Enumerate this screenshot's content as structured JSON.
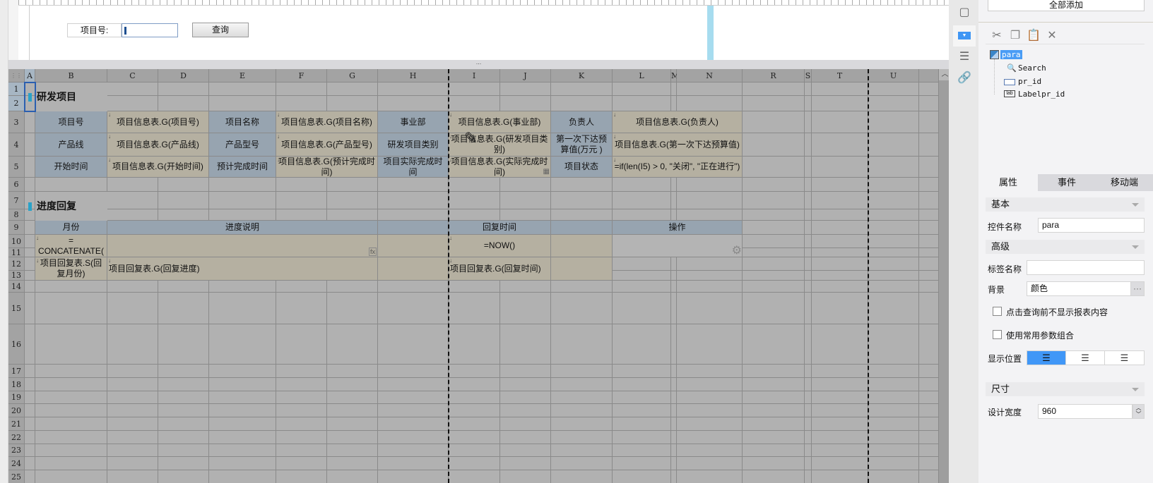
{
  "param_pane": {
    "label": "项目号:",
    "input_value": "",
    "query_button": "查询",
    "divider_grip": "..."
  },
  "sheet": {
    "corner": "⋮⋮",
    "columns": [
      "A",
      "B",
      "C",
      "D",
      "E",
      "F",
      "G",
      "H",
      "I",
      "J",
      "K",
      "L",
      "M",
      "N",
      "R",
      "S",
      "T",
      "U"
    ],
    "rows": [
      "1",
      "2",
      "3",
      "4",
      "5",
      "6",
      "7",
      "8",
      "9",
      "10",
      "11",
      "12",
      "13",
      "14",
      "15",
      "16",
      "17",
      "18",
      "19",
      "20",
      "21",
      "22",
      "23",
      "24",
      "25"
    ],
    "selected_cell": "A1:A2",
    "cells": [
      {
        "ref": "B1:B2",
        "text": "研发项目",
        "style": "heading"
      },
      {
        "ref": "B3",
        "text": "项目号",
        "style": "label"
      },
      {
        "ref": "C3:D3",
        "text": "项目信息表.G(项目号)",
        "style": "data"
      },
      {
        "ref": "E3",
        "text": "项目名称",
        "style": "label"
      },
      {
        "ref": "F3:G3",
        "text": "项目信息表.G(项目名称)",
        "style": "data"
      },
      {
        "ref": "H3",
        "text": "事业部",
        "style": "label"
      },
      {
        "ref": "I3:J3",
        "text": "项目信息表.G(事业部)",
        "style": "data"
      },
      {
        "ref": "K3",
        "text": "负责人",
        "style": "label"
      },
      {
        "ref": "L3:N3",
        "text": "项目信息表.G(负责人)",
        "style": "data"
      },
      {
        "ref": "B4",
        "text": "产品线",
        "style": "label"
      },
      {
        "ref": "C4:D4",
        "text": "项目信息表.G(产品线)",
        "style": "data"
      },
      {
        "ref": "E4",
        "text": "产品型号",
        "style": "label"
      },
      {
        "ref": "F4:G4",
        "text": "项目信息表.G(产品型号)",
        "style": "data"
      },
      {
        "ref": "H4",
        "text": "研发项目类别",
        "style": "label"
      },
      {
        "ref": "I4:J4",
        "text": "项目信息表.G(研发项目类别)",
        "style": "data"
      },
      {
        "ref": "K4",
        "text": "第一次下达预算值(万元 )",
        "style": "label"
      },
      {
        "ref": "L4:N4",
        "text": "项目信息表.G(第一次下达预算值)",
        "style": "data"
      },
      {
        "ref": "B5",
        "text": "开始时间",
        "style": "label"
      },
      {
        "ref": "C5:D5",
        "text": "项目信息表.G(开始时间)",
        "style": "data"
      },
      {
        "ref": "E5",
        "text": "预计完成时间",
        "style": "label"
      },
      {
        "ref": "F5:G5",
        "text": "项目信息表.G(预计完成时间)",
        "style": "data"
      },
      {
        "ref": "H5",
        "text": "项目实际完成时间",
        "style": "label"
      },
      {
        "ref": "I5:J5",
        "text": "项目信息表.G(实际完成时间)",
        "style": "data"
      },
      {
        "ref": "K5",
        "text": "项目状态",
        "style": "label"
      },
      {
        "ref": "L5:N5",
        "text": "=if(len(I5) > 0, \"关闭\", \"正在进行\")",
        "style": "data"
      },
      {
        "ref": "B7:B8",
        "text": "进度回复",
        "style": "heading"
      },
      {
        "ref": "B9",
        "text": "月份",
        "style": "label"
      },
      {
        "ref": "C9:G9",
        "text": "进度说明",
        "style": "label"
      },
      {
        "ref": "H9",
        "text": "",
        "style": "label"
      },
      {
        "ref": "I9:J9",
        "text": "回复时间",
        "style": "label"
      },
      {
        "ref": "K9",
        "text": "",
        "style": "label"
      },
      {
        "ref": "L9:N9",
        "text": "操作",
        "style": "label"
      },
      {
        "ref": "B10:B11",
        "text": "= CONCATENATE(",
        "style": "data"
      },
      {
        "ref": "C10:G11",
        "text": "",
        "style": "data"
      },
      {
        "ref": "H10:H11",
        "text": "",
        "style": "data"
      },
      {
        "ref": "I10:J11",
        "text": "=NOW()",
        "style": "data"
      },
      {
        "ref": "K10:K11",
        "text": "",
        "style": "data"
      },
      {
        "ref": "L10:N11",
        "text": "",
        "style": "op"
      },
      {
        "ref": "B12:B13",
        "text": "项目回复表.S(回复月份)",
        "style": "data"
      },
      {
        "ref": "C12:G13",
        "text": "项目回复表.G(回复进度)",
        "style": "data left"
      },
      {
        "ref": "H12:H13",
        "text": "",
        "style": "data"
      },
      {
        "ref": "I12:J13",
        "text": "项目回复表.G(回复时间)",
        "style": "data left"
      },
      {
        "ref": "K12:K13",
        "text": "",
        "style": "data"
      }
    ],
    "formula_badge": "fx"
  },
  "widget_panel": {
    "add_all_button": "全部添加",
    "toolbar": [
      "cut-icon",
      "copy-icon",
      "paste-icon",
      "delete-icon"
    ],
    "tree": [
      {
        "label": "para",
        "selected": true
      },
      {
        "label": "Search"
      },
      {
        "label": "pr_id"
      },
      {
        "label": "Labelpr_id"
      }
    ],
    "tree_icon_lab": "lab"
  },
  "properties": {
    "tabs": [
      "属性",
      "事件",
      "移动端"
    ],
    "active_tab": "属性",
    "section_basic": "基本",
    "widget_name_label": "控件名称",
    "widget_name_value": "para",
    "section_advanced": "高级",
    "tag_name_label": "标签名称",
    "tag_name_value": "",
    "background_label": "背景",
    "background_value": "颜色",
    "background_more": "···",
    "checkbox_hide_before_query": "点击查询前不显示报表内容",
    "checkbox_common_params": "使用常用参数组合",
    "display_position_label": "显示位置",
    "display_position": "left",
    "section_size": "尺寸",
    "design_width_label": "设计宽度",
    "design_width_value": "960"
  },
  "colors": {
    "label_cell": "#97a4b0",
    "data_cell": "#b5b0a1",
    "accent": "#4097f7",
    "marker": "#2aa2c8"
  }
}
